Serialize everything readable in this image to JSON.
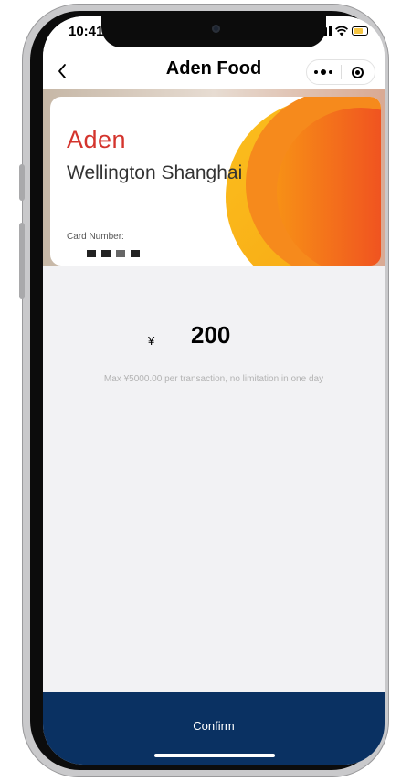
{
  "status_bar": {
    "time": "10:41"
  },
  "nav": {
    "title": "Aden Food"
  },
  "card": {
    "brand": "Aden",
    "branch": "Wellington Shanghai",
    "number_label": "Card Number:"
  },
  "amount": {
    "currency": "¥",
    "value": "200",
    "limit_note": "Max ¥5000.00 per transaction, no limitation in one day"
  },
  "confirm": {
    "label": "Confirm"
  },
  "colors": {
    "confirm_bar": "#0a3162",
    "brand_red": "#d4342d",
    "card_accent": "#f5841f"
  }
}
